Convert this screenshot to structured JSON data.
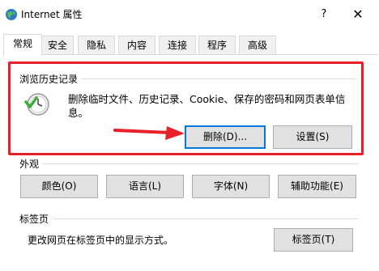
{
  "window": {
    "title": "Internet 属性",
    "help_glyph": "?",
    "close_glyph": "✕"
  },
  "tabs": [
    "常规",
    "安全",
    "隐私",
    "内容",
    "连接",
    "程序",
    "高级"
  ],
  "history": {
    "title": "浏览历史记录",
    "description_line1": "删除临时文件、历史记录、Cookie、保存的密码和网页表单信",
    "description_line2": "息。",
    "delete_label": "删除(D)...",
    "settings_label": "设置(S)"
  },
  "appearance": {
    "title": "外观",
    "colors_label": "颜色(O)",
    "languages_label": "语言(L)",
    "fonts_label": "字体(N)",
    "accessibility_label": "辅助功能(E)"
  },
  "tabs_group": {
    "title": "标签页",
    "description": "更改网页在标签页中的显示方式。",
    "tabs_button_label": "标签页(T)"
  },
  "colors": {
    "highlight": "#e8202a",
    "focus": "#0078d7"
  }
}
